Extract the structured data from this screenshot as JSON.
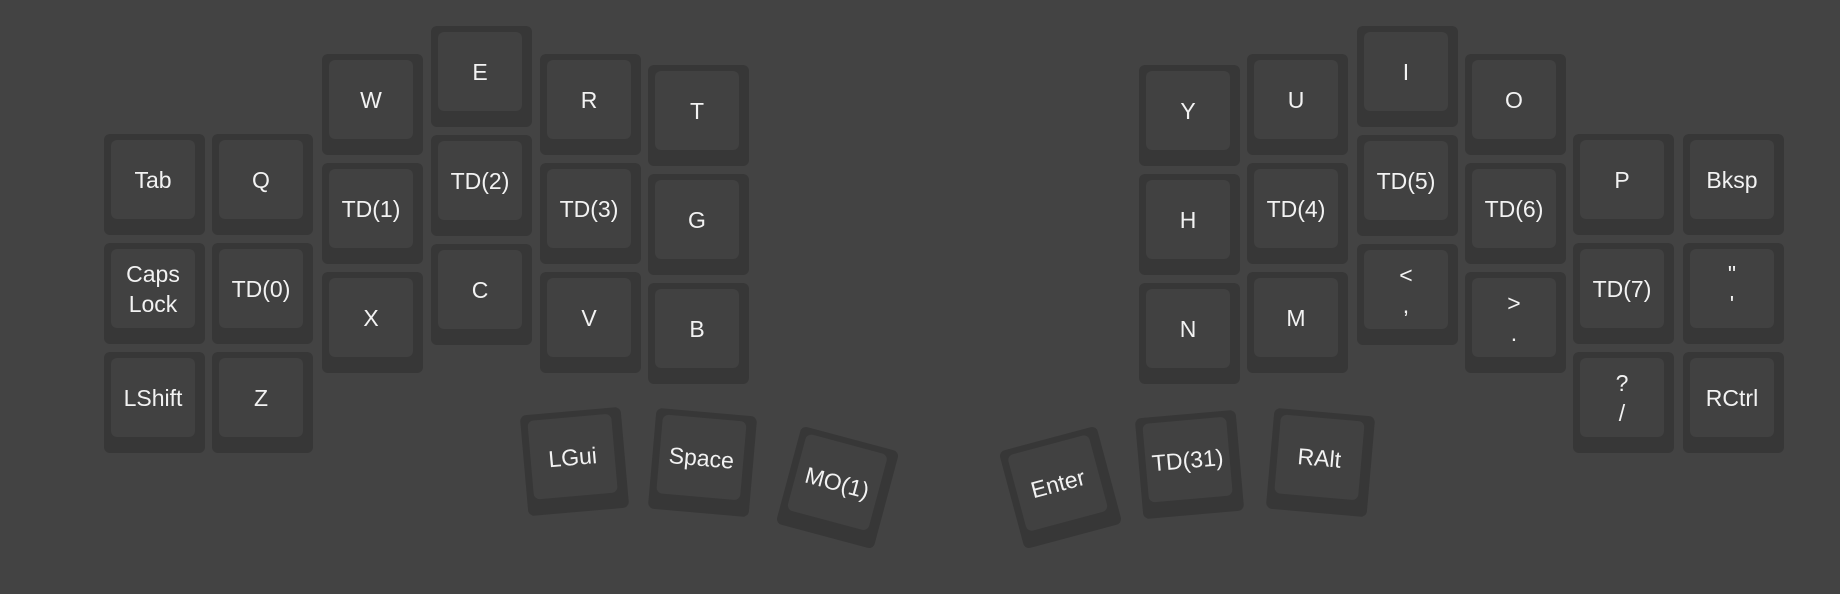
{
  "colors": {
    "background": "#434343",
    "key_outer": "#373737",
    "key_top": "#414141",
    "legend": "#f2f2f2"
  },
  "left": {
    "tab": "Tab",
    "caps": [
      "Caps",
      "Lock"
    ],
    "lshift": "LShift",
    "q": "Q",
    "td0": "TD(0)",
    "z": "Z",
    "w": "W",
    "td1": "TD(1)",
    "x": "X",
    "e": "E",
    "td2": "TD(2)",
    "c": "C",
    "r": "R",
    "td3": "TD(3)",
    "v": "V",
    "t": "T",
    "g": "G",
    "b": "B",
    "thumbs": {
      "lgui": "LGui",
      "space": "Space",
      "mo1": "MO(1)"
    }
  },
  "right": {
    "y": "Y",
    "h": "H",
    "n": "N",
    "u": "U",
    "td4": "TD(4)",
    "m": "M",
    "i": "I",
    "td5": "TD(5)",
    "comma": [
      "<",
      ","
    ],
    "o": "O",
    "td6": "TD(6)",
    "period": [
      ">",
      "."
    ],
    "p": "P",
    "td7": "TD(7)",
    "slash": [
      "?",
      "/"
    ],
    "bksp": "Bksp",
    "quote": [
      "\"",
      "'"
    ],
    "rctrl": "RCtrl",
    "thumbs": {
      "enter": "Enter",
      "td31": "TD(31)",
      "ralt": "RAlt"
    }
  }
}
